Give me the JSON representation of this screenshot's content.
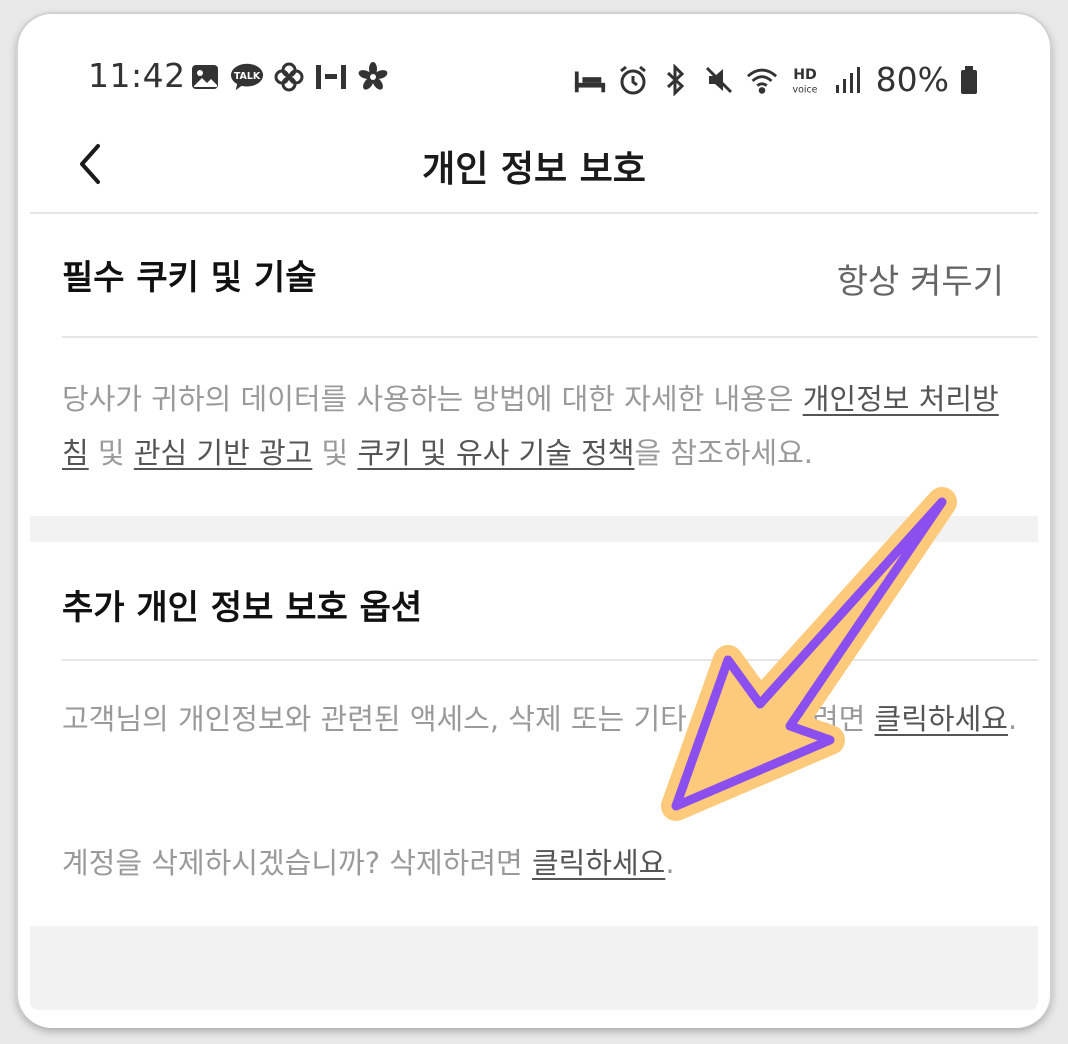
{
  "status_bar": {
    "time": "11:42",
    "battery": "80%",
    "left_icons": [
      "gallery-icon",
      "kakaotalk-icon",
      "pinwheel-icon",
      "h-icon",
      "flower-icon"
    ],
    "right_icons": [
      "bed-icon",
      "alarm-icon",
      "bluetooth-icon",
      "mute-icon",
      "wifi-icon",
      "hd-voice-icon",
      "signal-icon",
      "battery-icon"
    ],
    "kakao_label": "TALK",
    "hd_label": "HD",
    "voice_label": "voice"
  },
  "header": {
    "title": "개인 정보 보호"
  },
  "essential": {
    "heading": "필수 쿠키 및 기술",
    "status": "항상 켜두기",
    "desc_prefix": "당사가 귀하의 데이터를 사용하는 방법에 대한 자세한 내용은 ",
    "link_privacy": "개인정보 처리방침",
    "and1": " 및 ",
    "link_ads": "관심 기반 광고",
    "and2": " 및 ",
    "link_cookies": "쿠키 및 유사 기술 정책",
    "desc_suffix": "을 참조하세요."
  },
  "additional": {
    "heading": "추가 개인 정보 보호 옵션",
    "access_prefix": "고객님의 개인정보와 관련된 액세스, 삭제 또는 기타 요청을 하려면 ",
    "access_link": "클릭하세요",
    "access_suffix": ".",
    "delete_prefix": "계정을 삭제하시겠습니까? 삭제하려면 ",
    "delete_link": "클릭하세요",
    "delete_suffix": "."
  },
  "colors": {
    "arrow_fill": "#FDC97A",
    "arrow_stroke": "#8B4FF0"
  }
}
